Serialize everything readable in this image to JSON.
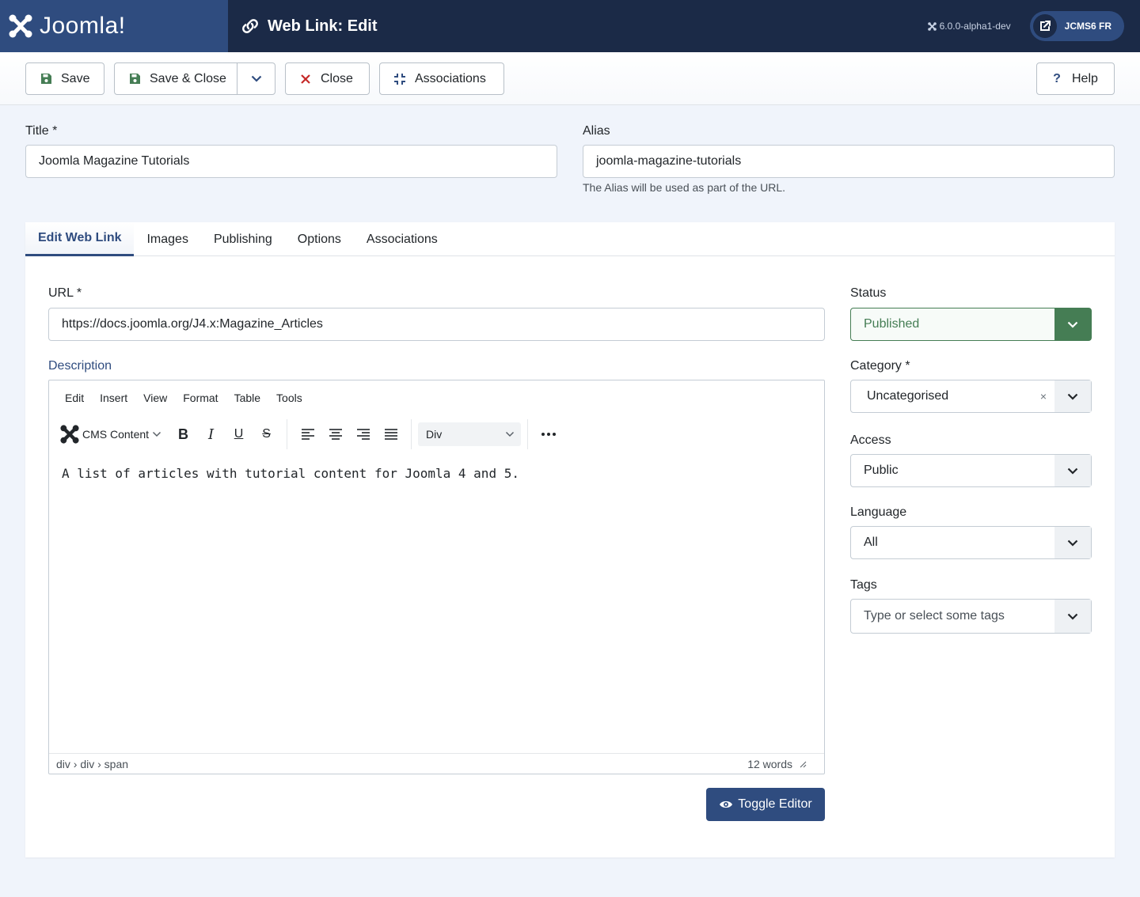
{
  "header": {
    "logo_text": "Joomla!",
    "page_title": "Web Link: Edit",
    "version": "6.0.0-alpha1-dev",
    "site_button": "JCMS6 FR"
  },
  "toolbar": {
    "save": "Save",
    "save_close": "Save & Close",
    "close": "Close",
    "associations": "Associations",
    "help": "Help"
  },
  "form": {
    "title_label": "Title *",
    "title_value": "Joomla Magazine Tutorials",
    "alias_label": "Alias",
    "alias_value": "joomla-magazine-tutorials",
    "alias_hint": "The Alias will be used as part of the URL."
  },
  "tabs": [
    "Edit Web Link",
    "Images",
    "Publishing",
    "Options",
    "Associations"
  ],
  "main": {
    "url_label": "URL *",
    "url_value": "https://docs.joomla.org/J4.x:Magazine_Articles",
    "description_label": "Description"
  },
  "editor": {
    "menus": [
      "Edit",
      "Insert",
      "View",
      "Format",
      "Table",
      "Tools"
    ],
    "cms_content": "CMS Content",
    "block_format": "Div",
    "content": "A list of articles with tutorial content for Joomla 4 and 5.",
    "path": "div › div › span",
    "word_count": "12 words",
    "toggle_label": "Toggle Editor"
  },
  "sidebar": {
    "status_label": "Status",
    "status_value": "Published",
    "category_label": "Category *",
    "category_value": "Uncategorised",
    "access_label": "Access",
    "access_value": "Public",
    "language_label": "Language",
    "language_value": "All",
    "tags_label": "Tags",
    "tags_placeholder": "Type or select some tags"
  },
  "colors": {
    "header_bg": "#1b2a47",
    "accent": "#2f4c7f",
    "success": "#457d54",
    "danger": "#c52827"
  }
}
